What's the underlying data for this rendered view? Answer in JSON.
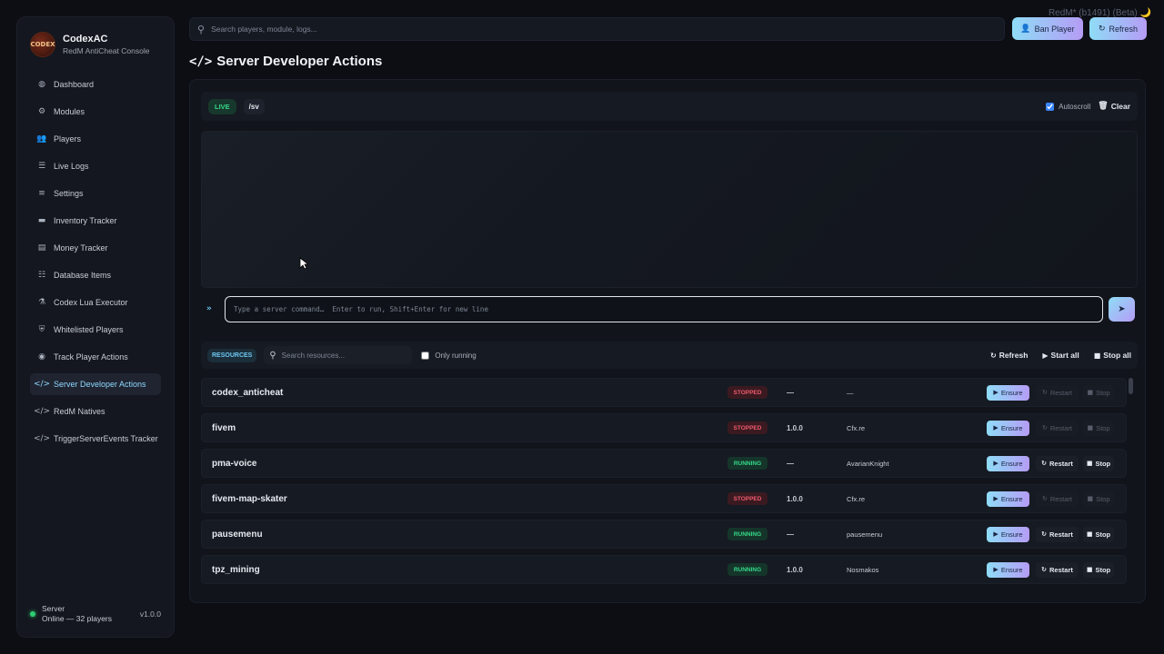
{
  "brand": {
    "name": "CodexAC",
    "subtitle": "RedM AntiCheat Console",
    "logo_text": "CODEX"
  },
  "sidebar": {
    "items": [
      {
        "label": "Dashboard",
        "icon": "dashboard-icon",
        "glyph": "◍"
      },
      {
        "label": "Modules",
        "icon": "cogs-icon",
        "glyph": "⚙"
      },
      {
        "label": "Players",
        "icon": "users-icon",
        "glyph": "👥"
      },
      {
        "label": "Live Logs",
        "icon": "list-icon",
        "glyph": "☰"
      },
      {
        "label": "Settings",
        "icon": "sliders-icon",
        "glyph": "≡"
      },
      {
        "label": "Inventory Tracker",
        "icon": "box-icon",
        "glyph": "▬"
      },
      {
        "label": "Money Tracker",
        "icon": "money-icon",
        "glyph": "▤"
      },
      {
        "label": "Database Items",
        "icon": "database-icon",
        "glyph": "☷"
      },
      {
        "label": "Codex Lua Executor",
        "icon": "flask-icon",
        "glyph": "⚗"
      },
      {
        "label": "Whitelisted Players",
        "icon": "shield-icon",
        "glyph": "⛨"
      },
      {
        "label": "Track Player Actions",
        "icon": "eye-icon",
        "glyph": "◉"
      },
      {
        "label": "Server Developer Actions",
        "icon": "code-icon",
        "glyph": "</>",
        "active": true
      },
      {
        "label": "RedM Natives",
        "icon": "code-icon",
        "glyph": "</>"
      },
      {
        "label": "TriggerServerEvents Tracker",
        "icon": "code-icon",
        "glyph": "</>"
      }
    ]
  },
  "server_status": {
    "label": "Server",
    "detail": "Online — 32 players",
    "version": "v1.0.0"
  },
  "topbar": {
    "search_placeholder": "Search players, module, logs...",
    "redm_badge": "RedM* (b1491) (Beta) 🌙",
    "ban_label": "Ban Player",
    "refresh_label": "Refresh"
  },
  "page": {
    "title": "Server Developer Actions"
  },
  "console": {
    "live_label": "LIVE",
    "command_label": "/sv",
    "autoscroll_label": "Autoscroll",
    "autoscroll_checked": true,
    "clear_label": "Clear",
    "input_placeholder": "Type a server command…  Enter to run, Shift+Enter for new line"
  },
  "resources": {
    "label": "RESOURCES",
    "search_placeholder": "Search resources...",
    "only_running_label": "Only running",
    "refresh_label": "Refresh",
    "start_all_label": "Start all",
    "stop_all_label": "Stop all",
    "ensure_label": "Ensure",
    "restart_label": "Restart",
    "stop_label": "Stop",
    "rows": [
      {
        "name": "codex_anticheat",
        "status": "STOPPED",
        "version": "—",
        "author": "—"
      },
      {
        "name": "fivem",
        "status": "STOPPED",
        "version": "1.0.0",
        "author": "Cfx.re"
      },
      {
        "name": "pma-voice",
        "status": "RUNNING",
        "version": "—",
        "author": "AvarianKnight"
      },
      {
        "name": "fivem-map-skater",
        "status": "STOPPED",
        "version": "1.0.0",
        "author": "Cfx.re"
      },
      {
        "name": "pausemenu",
        "status": "RUNNING",
        "version": "—",
        "author": "pausemenu"
      },
      {
        "name": "tpz_mining",
        "status": "RUNNING",
        "version": "1.0.0",
        "author": "Nosmakos"
      }
    ]
  },
  "colors": {
    "accent_start": "#8fdcf7",
    "accent_end": "#b59cf5",
    "running": "#36d98a",
    "stopped": "#ee5a6e"
  }
}
